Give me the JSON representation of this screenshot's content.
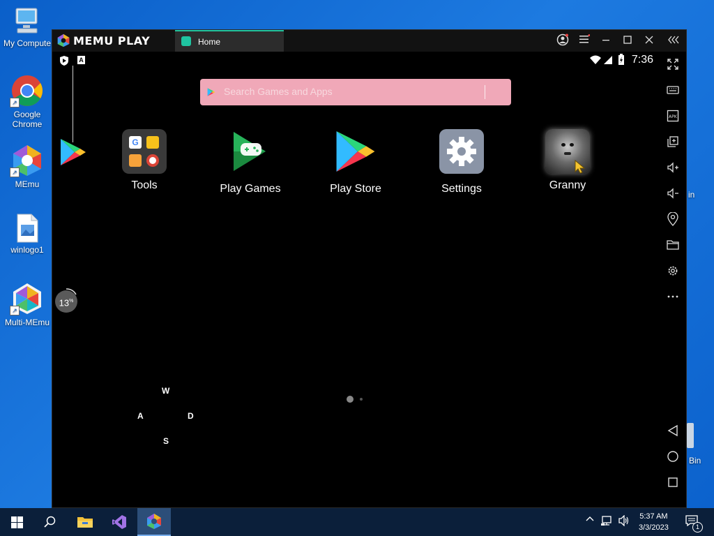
{
  "desktop": {
    "icons": [
      {
        "label": "My Compute"
      },
      {
        "label": "Google Chrome"
      },
      {
        "label": "MEmu"
      },
      {
        "label": "winlogo1"
      },
      {
        "label": "Multi-MEmu"
      }
    ],
    "partial_labels": {
      "right_top": "in",
      "right_bottom": "Bin"
    }
  },
  "window": {
    "brand": "MEMU PLAY",
    "tab_label": "Home",
    "statusbar_time": "7:36",
    "search": {
      "placeholder": "Search Games and Apps",
      "value": ""
    },
    "apps": [
      {
        "label": "Tools"
      },
      {
        "label": "Play Games"
      },
      {
        "label": "Play Store"
      },
      {
        "label": "Settings"
      },
      {
        "label": "Granny"
      }
    ],
    "progress": {
      "value": "13",
      "unit": "%"
    },
    "keymap": {
      "up": "W",
      "left": "A",
      "right": "D",
      "down": "S"
    },
    "status_icons": [
      "shield-icon",
      "a-badge-icon",
      "wifi-icon",
      "signal-icon",
      "battery-icon"
    ],
    "sidebar_icons": [
      "fullscreen-icon",
      "keyboard-icon",
      "apk-icon",
      "multi-window-icon",
      "volume-up-icon",
      "volume-down-icon",
      "location-icon",
      "folder-icon",
      "settings-gear-icon",
      "more-icon",
      "back-icon",
      "home-icon",
      "recents-icon"
    ],
    "titlebar_icons": [
      "account-icon",
      "menu-icon",
      "minimize-icon",
      "maximize-icon",
      "close-icon",
      "collapse-sidebar-icon"
    ]
  },
  "taskbar": {
    "time": "5:37 AM",
    "date": "3/3/2023",
    "notification_count": "1"
  },
  "colors": {
    "accent": "#1fc4a1",
    "search_bg": "#f0a8b8",
    "desktop_blue": "#1d7ae0",
    "taskbar_bg": "#0b1f3a"
  }
}
